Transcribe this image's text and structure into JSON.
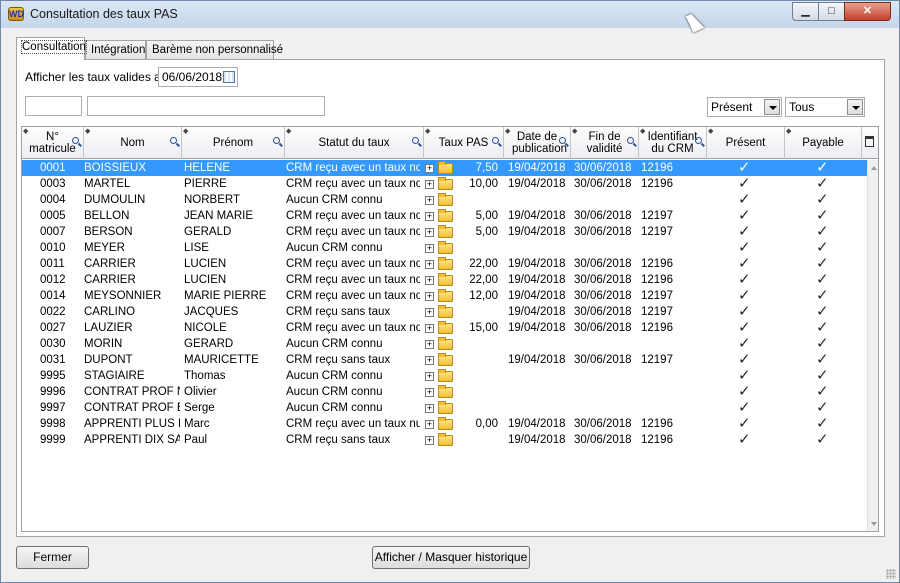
{
  "window": {
    "title": "Consultation des taux PAS",
    "app_icon_text": "WD"
  },
  "tabs": [
    {
      "label": "Consultation"
    },
    {
      "label": "Intégration"
    },
    {
      "label": "Barème non personnalisé"
    }
  ],
  "filters": {
    "date_label": "Afficher les taux valides au",
    "date_value": "06/06/2018",
    "filter1_value": "",
    "filter2_value": "",
    "present_select": "Présent",
    "payable_select": "Tous"
  },
  "table": {
    "columns": [
      "N° matricule",
      "Nom",
      "Prénom",
      "Statut du taux",
      "Taux PAS",
      "Date de publication",
      "Fin de validité",
      "Identifiant du CRM",
      "Présent",
      "Payable"
    ],
    "rows": [
      {
        "mat": "0001",
        "nom": "BOISSIEUX",
        "prenom": "HELENE",
        "statut": "CRM reçu avec un taux nor",
        "taux": "7,50",
        "pub": "19/04/2018",
        "fin": "30/06/2018",
        "crm": "12196",
        "present": "✓",
        "payable": "✓"
      },
      {
        "mat": "0003",
        "nom": "MARTEL",
        "prenom": "PIERRE",
        "statut": "CRM reçu avec un taux nor",
        "taux": "10,00",
        "pub": "19/04/2018",
        "fin": "30/06/2018",
        "crm": "12196",
        "present": "✓",
        "payable": "✓"
      },
      {
        "mat": "0004",
        "nom": "DUMOULIN",
        "prenom": "NORBERT",
        "statut": "Aucun CRM connu",
        "taux": "",
        "pub": "",
        "fin": "",
        "crm": "",
        "present": "✓",
        "payable": "✓"
      },
      {
        "mat": "0005",
        "nom": "BELLON",
        "prenom": "JEAN MARIE",
        "statut": "CRM reçu avec un taux nor",
        "taux": "5,00",
        "pub": "19/04/2018",
        "fin": "30/06/2018",
        "crm": "12197",
        "present": "✓",
        "payable": "✓"
      },
      {
        "mat": "0007",
        "nom": "BERSON",
        "prenom": "GERALD",
        "statut": "CRM reçu avec un taux nor",
        "taux": "5,00",
        "pub": "19/04/2018",
        "fin": "30/06/2018",
        "crm": "12197",
        "present": "✓",
        "payable": "✓"
      },
      {
        "mat": "0010",
        "nom": "MEYER",
        "prenom": "LISE",
        "statut": "Aucun CRM connu",
        "taux": "",
        "pub": "",
        "fin": "",
        "crm": "",
        "present": "✓",
        "payable": "✓"
      },
      {
        "mat": "0011",
        "nom": "CARRIER",
        "prenom": "LUCIEN",
        "statut": "CRM reçu avec un taux nor",
        "taux": "22,00",
        "pub": "19/04/2018",
        "fin": "30/06/2018",
        "crm": "12196",
        "present": "✓",
        "payable": "✓"
      },
      {
        "mat": "0012",
        "nom": "CARRIER",
        "prenom": "LUCIEN",
        "statut": "CRM reçu avec un taux nor",
        "taux": "22,00",
        "pub": "19/04/2018",
        "fin": "30/06/2018",
        "crm": "12196",
        "present": "✓",
        "payable": "✓"
      },
      {
        "mat": "0014",
        "nom": "MEYSONNIER",
        "prenom": "MARIE PIERRE",
        "statut": "CRM reçu avec un taux nor",
        "taux": "12,00",
        "pub": "19/04/2018",
        "fin": "30/06/2018",
        "crm": "12197",
        "present": "✓",
        "payable": "✓"
      },
      {
        "mat": "0022",
        "nom": "CARLINO",
        "prenom": "JACQUES",
        "statut": "CRM reçu sans taux",
        "taux": "",
        "pub": "19/04/2018",
        "fin": "30/06/2018",
        "crm": "12197",
        "present": "✓",
        "payable": "✓"
      },
      {
        "mat": "0027",
        "nom": "LAUZIER",
        "prenom": "NICOLE",
        "statut": "CRM reçu avec un taux nor",
        "taux": "15,00",
        "pub": "19/04/2018",
        "fin": "30/06/2018",
        "crm": "12196",
        "present": "✓",
        "payable": "✓"
      },
      {
        "mat": "0030",
        "nom": "MORIN",
        "prenom": "GERARD",
        "statut": "Aucun CRM connu",
        "taux": "",
        "pub": "",
        "fin": "",
        "crm": "",
        "present": "✓",
        "payable": "✓"
      },
      {
        "mat": "0031",
        "nom": "DUPONT",
        "prenom": "MAURICETTE",
        "statut": "CRM reçu sans taux",
        "taux": "",
        "pub": "19/04/2018",
        "fin": "30/06/2018",
        "crm": "12197",
        "present": "✓",
        "payable": "✓"
      },
      {
        "mat": "9995",
        "nom": "STAGIAIRE",
        "prenom": "Thomas",
        "statut": "Aucun CRM connu",
        "taux": "",
        "pub": "",
        "fin": "",
        "crm": "",
        "present": "✓",
        "payable": "✓"
      },
      {
        "mat": "9996",
        "nom": "CONTRAT PROF N",
        "prenom": "Olivier",
        "statut": "Aucun CRM connu",
        "taux": "",
        "pub": "",
        "fin": "",
        "crm": "",
        "present": "✓",
        "payable": "✓"
      },
      {
        "mat": "9997",
        "nom": "CONTRAT PROF E",
        "prenom": "Serge",
        "statut": "Aucun CRM connu",
        "taux": "",
        "pub": "",
        "fin": "",
        "crm": "",
        "present": "✓",
        "payable": "✓"
      },
      {
        "mat": "9998",
        "nom": "APPRENTI PLUS D",
        "prenom": "Marc",
        "statut": "CRM reçu avec un taux nul",
        "taux": "0,00",
        "pub": "19/04/2018",
        "fin": "30/06/2018",
        "crm": "12196",
        "present": "✓",
        "payable": "✓"
      },
      {
        "mat": "9999",
        "nom": "APPRENTI DIX SAI",
        "prenom": "Paul",
        "statut": "CRM reçu sans taux",
        "taux": "",
        "pub": "19/04/2018",
        "fin": "30/06/2018",
        "crm": "12196",
        "present": "✓",
        "payable": "✓"
      }
    ]
  },
  "buttons": {
    "close": "Fermer",
    "history": "Afficher / Masquer historique"
  },
  "icons": {
    "plus_glyph": "+"
  }
}
